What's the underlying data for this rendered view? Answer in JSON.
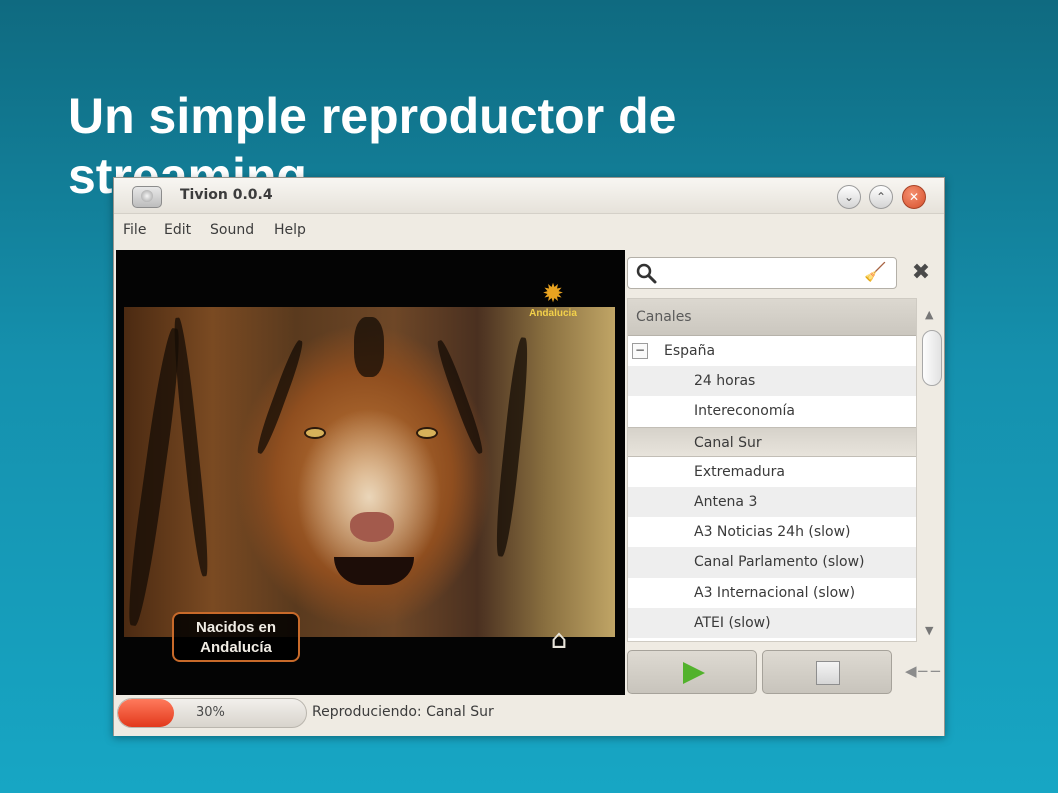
{
  "slide": {
    "title": "Un simple reproductor de streaming"
  },
  "window": {
    "title": "Tivion 0.0.4",
    "controls": {
      "minimize": "⌄",
      "maximize": "⌃",
      "close": "✕"
    }
  },
  "menu": {
    "items": [
      "File",
      "Edit",
      "Sound",
      "Help"
    ]
  },
  "video": {
    "channel_logo_text": "Andalucia",
    "overlay_text": "Nacidos en\nAndalucía"
  },
  "search": {
    "value": "",
    "placeholder": ""
  },
  "channels": {
    "header": "Canales",
    "group": "España",
    "collapse_symbol": "−",
    "items": [
      {
        "label": "24 horas"
      },
      {
        "label": "Intereconomía"
      },
      {
        "label": "Canal Sur"
      },
      {
        "label": "Extremadura"
      },
      {
        "label": "Antena 3"
      },
      {
        "label": "A3 Noticias 24h (slow)"
      },
      {
        "label": "Canal Parlamento (slow)"
      },
      {
        "label": "A3 Internacional (slow)"
      },
      {
        "label": "ATEI (slow)"
      }
    ],
    "selected": "Canal Sur"
  },
  "status": {
    "progress_percent": 30,
    "progress_label": "30%",
    "text": "Reproduciendo: Canal Sur"
  },
  "icons": {
    "search": "search-icon",
    "clear_search": "broom-icon",
    "close_panel": "close-icon",
    "play": "play-icon",
    "stop": "stop-icon",
    "volume": "volume-icon"
  },
  "colors": {
    "progress_fill": "#e2391c",
    "play_icon": "#52b22c",
    "background_top": "#0f6a80",
    "background_bottom": "#17a6c4"
  }
}
